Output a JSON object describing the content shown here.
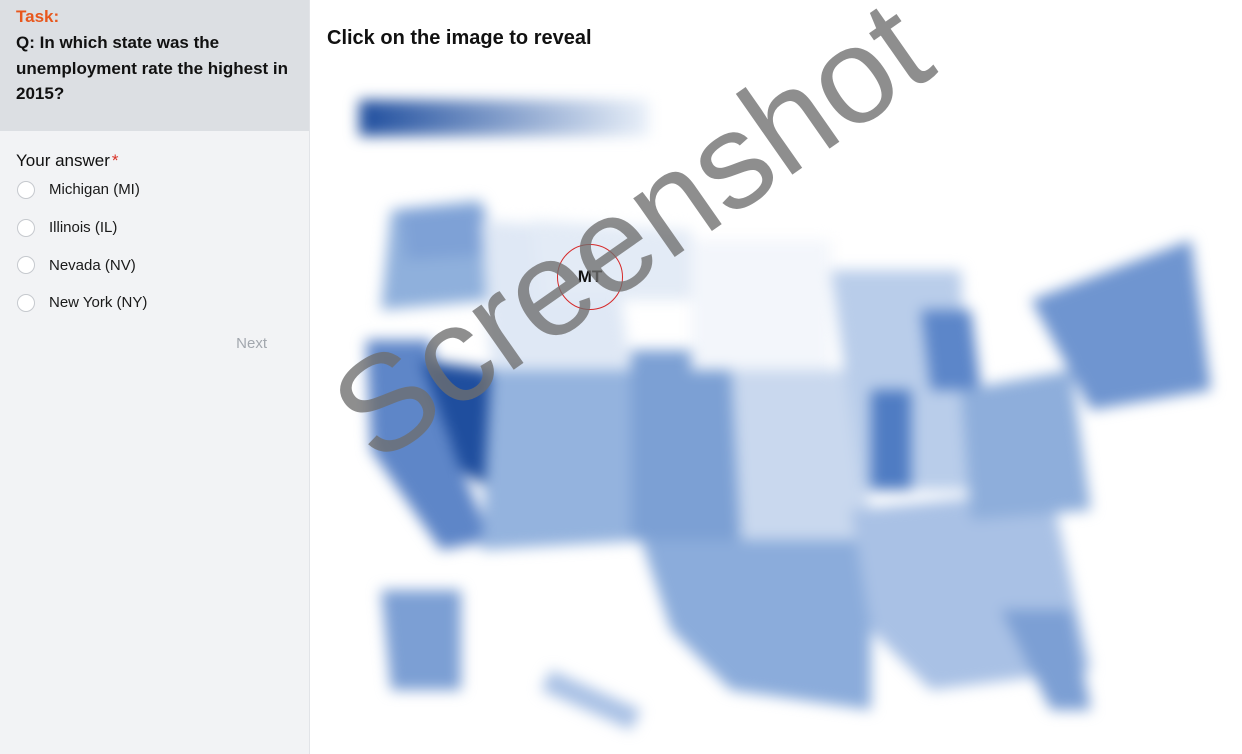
{
  "sidebar": {
    "task_label": "Task:",
    "question": "Q: In which state was the unemployment rate the highest in 2015?",
    "answer_heading": "Your answer",
    "required_marker": "*",
    "options": [
      {
        "label": "Michigan (MI)"
      },
      {
        "label": "Illinois (IL)"
      },
      {
        "label": "Nevada (NV)"
      },
      {
        "label": "New York (NY)"
      }
    ],
    "next_label": "Next"
  },
  "main": {
    "title": "Click on the image to reveal",
    "marker_label": "MT",
    "watermark": "Screenshot"
  },
  "colors": {
    "task_label": "#e8571d",
    "required": "#d93025",
    "marker_ring": "#d62828",
    "map_dark": "#1f4e9e",
    "map_light": "#dbe6f4"
  }
}
